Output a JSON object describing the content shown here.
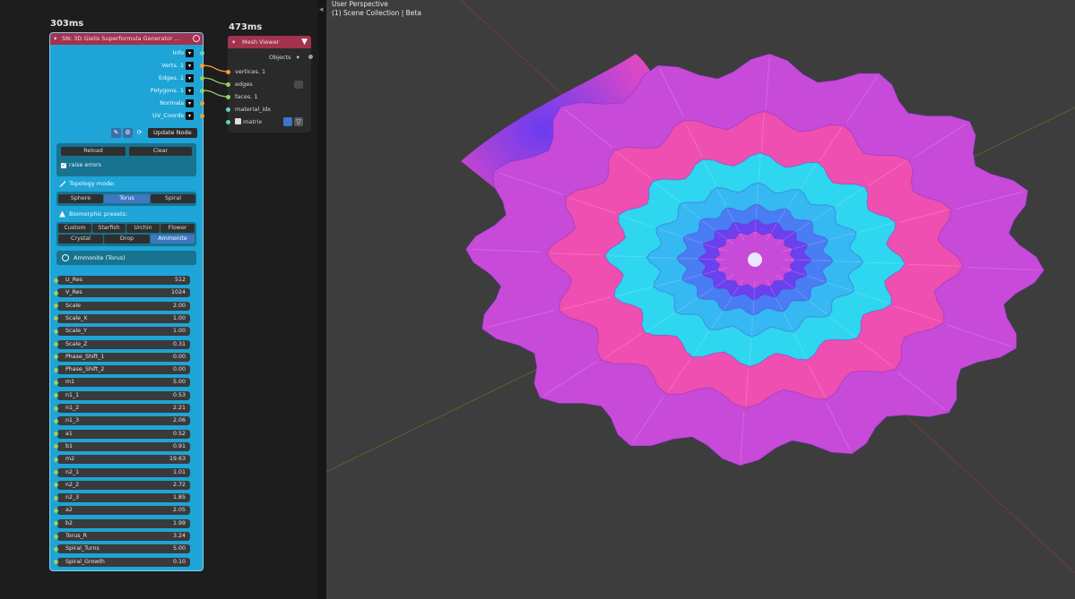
{
  "timings": {
    "sn": "303ms",
    "mv": "473ms"
  },
  "sn_node": {
    "title": "SN: 3D Gielis Superformula Generator ...",
    "outputs": [
      {
        "label": "Info"
      },
      {
        "label": "Verts. 1"
      },
      {
        "label": "Edges. 1"
      },
      {
        "label": "Polygons. 1"
      },
      {
        "label": "Normals"
      },
      {
        "label": "UV_Coords"
      }
    ],
    "update_label": "Update Node",
    "reload_label": "Reload",
    "clear_label": "Clear",
    "raise_errors_label": "raise errors",
    "topology_label": "Topology mode:",
    "topology_options": [
      "Sphere",
      "Torus",
      "Spiral"
    ],
    "topology_selected": "Torus",
    "biomorphic_label": "Biomorphic presets:",
    "presets_row1": [
      "Custom",
      "Starfish",
      "Urchin",
      "Flower"
    ],
    "presets_row2": [
      "Crystal",
      "Drop",
      "Ammonite"
    ],
    "preset_selected": "Ammonite",
    "preset_name": "Ammonite (Torus)",
    "params": [
      {
        "name": "U_Res",
        "value": "512"
      },
      {
        "name": "V_Res",
        "value": "1024"
      },
      {
        "name": "Scale",
        "value": "2.00"
      },
      {
        "name": "Scale_X",
        "value": "1.00"
      },
      {
        "name": "Scale_Y",
        "value": "1.00"
      },
      {
        "name": "Scale_Z",
        "value": "0.31"
      },
      {
        "name": "Phase_Shift_1",
        "value": "0.00"
      },
      {
        "name": "Phase_Shift_2",
        "value": "0.00"
      },
      {
        "name": "m1",
        "value": "5.00"
      },
      {
        "name": "n1_1",
        "value": "0.53"
      },
      {
        "name": "n1_2",
        "value": "2.21"
      },
      {
        "name": "n1_3",
        "value": "2.06"
      },
      {
        "name": "a1",
        "value": "0.52"
      },
      {
        "name": "b1",
        "value": "0.91"
      },
      {
        "name": "m2",
        "value": "19.63"
      },
      {
        "name": "n2_1",
        "value": "1.01"
      },
      {
        "name": "n2_2",
        "value": "2.72"
      },
      {
        "name": "n2_3",
        "value": "1.85"
      },
      {
        "name": "a2",
        "value": "2.05"
      },
      {
        "name": "b2",
        "value": "1.99"
      },
      {
        "name": "Torus_R",
        "value": "3.24"
      },
      {
        "name": "Spiral_Turns",
        "value": "5.00"
      },
      {
        "name": "Spiral_Growth",
        "value": "0.10"
      }
    ]
  },
  "mv_node": {
    "title": "Mesh Viewer",
    "objects_label": "Objects",
    "inputs": [
      "vertices. 1",
      "edges",
      "faces. 1",
      "material_idx",
      "matrix"
    ]
  },
  "viewport": {
    "perspective": "User Perspective",
    "collection": "(1) Scene Collection | Beta"
  },
  "colors": {
    "node_body": "#1ea4d6",
    "node_header": "#a3324f",
    "viewport_bg": "#3d3d3d",
    "editor_bg": "#1d1d1d",
    "mesh_pink": "#e63fc6",
    "mesh_blue": "#5a3ef0",
    "mesh_cyan": "#2ed0f2"
  },
  "icons": [
    "gear-icon",
    "dropdown-arrow-icon",
    "refresh-icon",
    "viewer-icon",
    "checkbox-icon",
    "spiral-icon"
  ]
}
